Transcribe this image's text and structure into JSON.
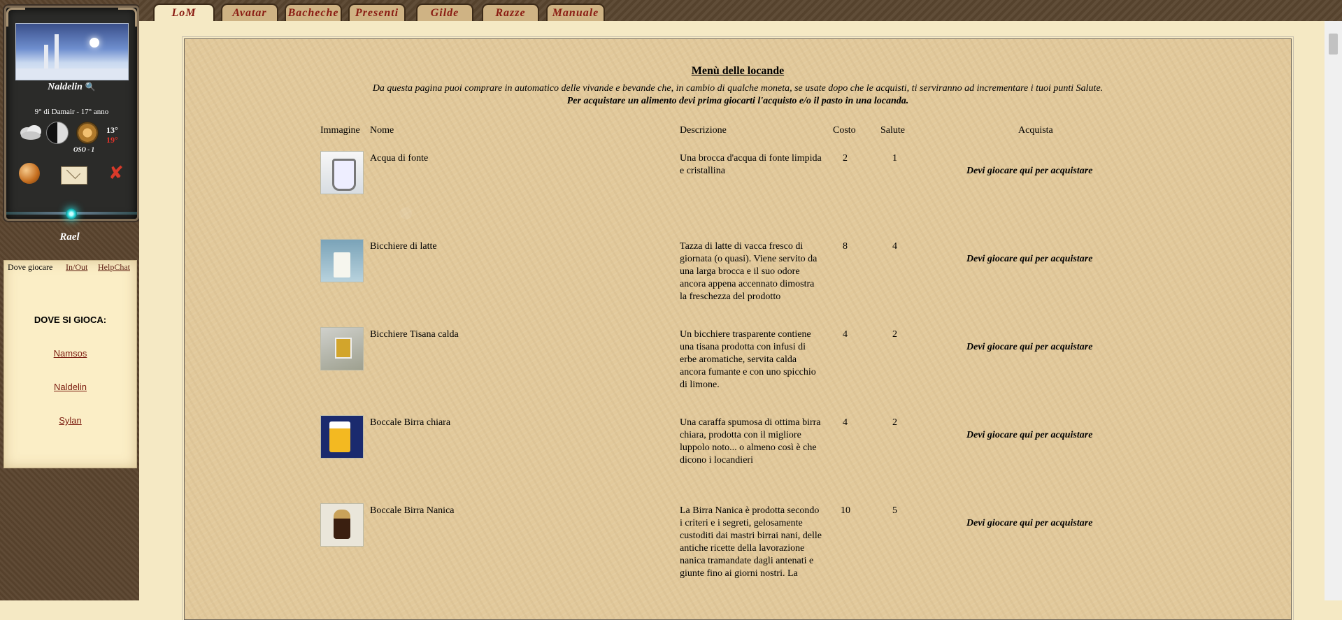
{
  "sidebar": {
    "location": "Naldelin",
    "date": "9° di Damair - 17° anno",
    "wind": "OSO - 1",
    "temp_main": "13°",
    "temp_secondary": "19°",
    "user": "Rael",
    "tabs": [
      "Dove giocare",
      "In/Out",
      "HelpChat"
    ],
    "where_title": "DOVE SI GIOCA:",
    "places": [
      "Namsos",
      "Naldelin",
      "Sylan"
    ]
  },
  "top_tabs": [
    "LoM",
    "Avatar",
    "Bacheche",
    "Presenti",
    "Gilde",
    "Razze",
    "Manuale"
  ],
  "page": {
    "title": "Menù delle locande",
    "intro": "Da questa pagina puoi comprare in automatico delle vivande e bevande che, in cambio di qualche moneta, se usate dopo che le acquisti, ti serviranno ad incrementare i tuoi punti Salute.",
    "intro_bold": "Per acquistare un alimento devi prima giocarti l'acquisto e/o il pasto in una locanda."
  },
  "table": {
    "headers": [
      "Immagine",
      "Nome",
      "Descrizione",
      "Costo",
      "Salute",
      "Acquista"
    ],
    "rows": [
      {
        "name": "Acqua di fonte",
        "desc": "Una brocca d'acqua di fonte limpida e cristallina",
        "cost": "2",
        "health": "1",
        "buy": "Devi giocare qui per acquistare",
        "icon": "water-pitcher-icon"
      },
      {
        "name": "Bicchiere di latte",
        "desc": "Tazza di latte di vacca fresco di giornata (o quasi). Viene servito da una larga brocca e il suo odore ancora appena accennato dimostra la freschezza del prodotto",
        "cost": "8",
        "health": "4",
        "buy": "Devi giocare qui per acquistare",
        "icon": "milk-glass-icon"
      },
      {
        "name": "Bicchiere Tisana calda",
        "desc": "Un bicchiere trasparente contiene una tisana prodotta con infusi di erbe aromatiche, servita calda ancora fumante e con uno spicchio di limone.",
        "cost": "4",
        "health": "2",
        "buy": "Devi giocare qui per acquistare",
        "icon": "herbal-tea-icon"
      },
      {
        "name": "Boccale Birra chiara",
        "desc": "Una caraffa spumosa di ottima birra chiara, prodotta con il migliore luppolo noto... o almeno così è che dicono i locandieri",
        "cost": "4",
        "health": "2",
        "buy": "Devi giocare qui per acquistare",
        "icon": "beer-mug-icon"
      },
      {
        "name": "Boccale Birra Nanica",
        "desc": "La Birra Nanica è prodotta secondo i criteri e i segreti, gelosamente custoditi dai mastri birrai nani, delle antiche ricette della lavorazione nanica tramandate dagli antenati e giunte fino ai giorni nostri. La",
        "cost": "10",
        "health": "5",
        "buy": "Devi giocare qui per acquistare",
        "icon": "dwarf-beer-icon"
      }
    ]
  }
}
